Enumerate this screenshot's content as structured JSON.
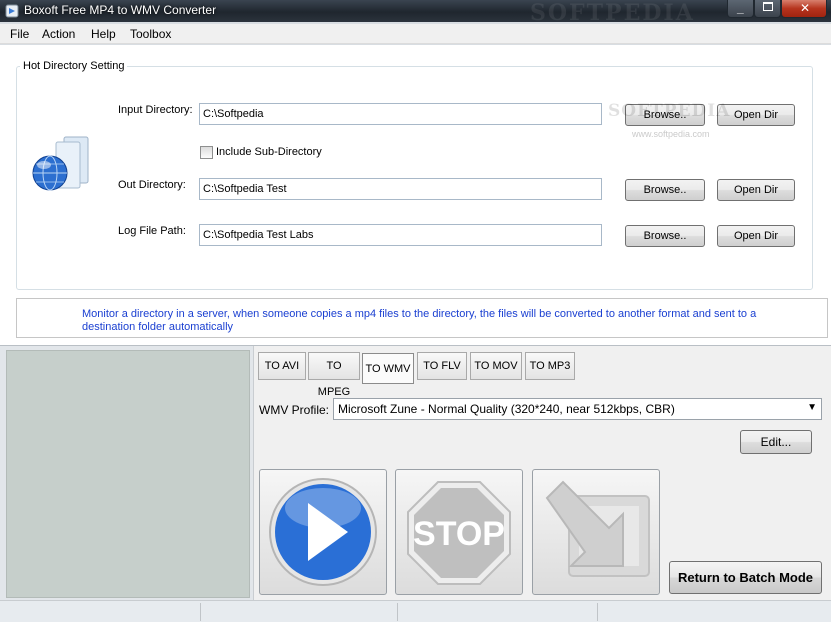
{
  "window": {
    "title": "Boxoft Free MP4 to WMV Converter",
    "watermark": "SOFTPEDIA"
  },
  "menu": [
    "File",
    "Action",
    "Help",
    "Toolbox"
  ],
  "hot_directory": {
    "group_label": "Hot Directory Setting",
    "input_directory": {
      "label": "Input Directory:",
      "value": "C:\\Softpedia",
      "browse": "Browse..",
      "open": "Open Dir"
    },
    "include_sub": {
      "label": "Include Sub-Directory",
      "checked": false
    },
    "out_directory": {
      "label": "Out Directory:",
      "value": "C:\\Softpedia Test",
      "browse": "Browse..",
      "open": "Open Dir"
    },
    "log_file": {
      "label": "Log File Path:",
      "value": "C:\\Softpedia Test Labs",
      "browse": "Browse..",
      "open": "Open Dir"
    },
    "watermark": "SOFTPEDIA",
    "watermark_url": "www.softpedia.com"
  },
  "info_text": "Monitor a directory in a server, when someone copies a mp4 files to the directory, the files will be converted to another format and sent to a destination folder automatically",
  "tabs": [
    "TO AVI",
    "TO MPEG",
    "TO WMV",
    "TO FLV",
    "TO MOV",
    "TO MP3"
  ],
  "active_tab": "TO WMV",
  "profile": {
    "label": "WMV Profile:",
    "value": "Microsoft Zune - Normal Quality (320*240, near 512kbps, CBR)",
    "edit": "Edit..."
  },
  "actions": {
    "stop_label": "STOP",
    "return_label": "Return to Batch Mode"
  },
  "colors": {
    "info_text": "#1a3fd1",
    "left_panel": "#c6cfcb",
    "play_blue": "#2a6fd6",
    "stop_red": "#c8c8c8"
  }
}
